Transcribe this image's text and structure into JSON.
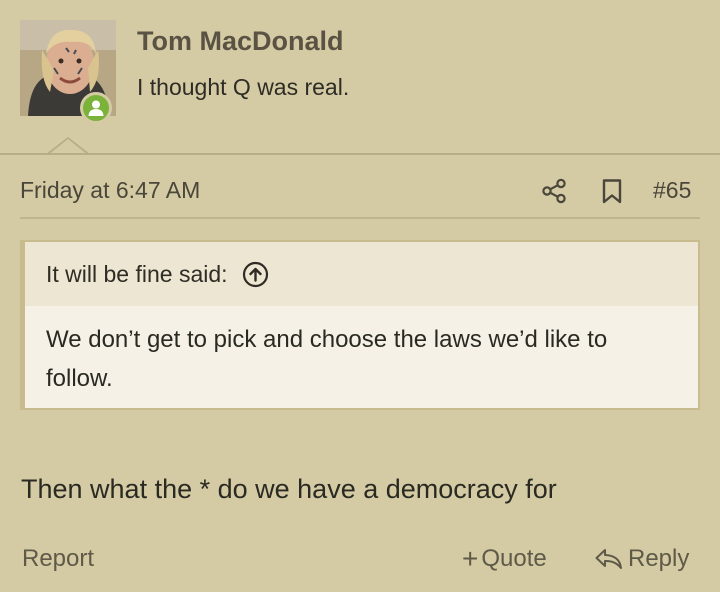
{
  "user": {
    "name": "Tom MacDonald",
    "title": "I thought Q was real.",
    "avatar_icon": "avatar-photo",
    "status_icon": "online-user-icon",
    "status_color": "#7bb33a"
  },
  "meta": {
    "date": "Friday at 6:47 AM",
    "share_icon": "share-icon",
    "bookmark_icon": "bookmark-icon",
    "post_number": "#65"
  },
  "quote": {
    "header": "It will be fine said:",
    "jump_icon": "arrow-up-circle-icon",
    "text": "We don’t get to pick and choose the laws we’d like to follow."
  },
  "message": "Then what the * do we have a democracy for",
  "footer": {
    "report": "Report",
    "quote_plus": "+",
    "quote": "Quote",
    "reply": "Reply",
    "reply_icon": "reply-arrow-icon"
  },
  "colors": {
    "background": "#d4cba5",
    "quote_bg": "#f6f1e6",
    "quote_header_bg": "#ede6d2",
    "accent_text": "#5a5243",
    "online_green": "#7bb33a"
  }
}
